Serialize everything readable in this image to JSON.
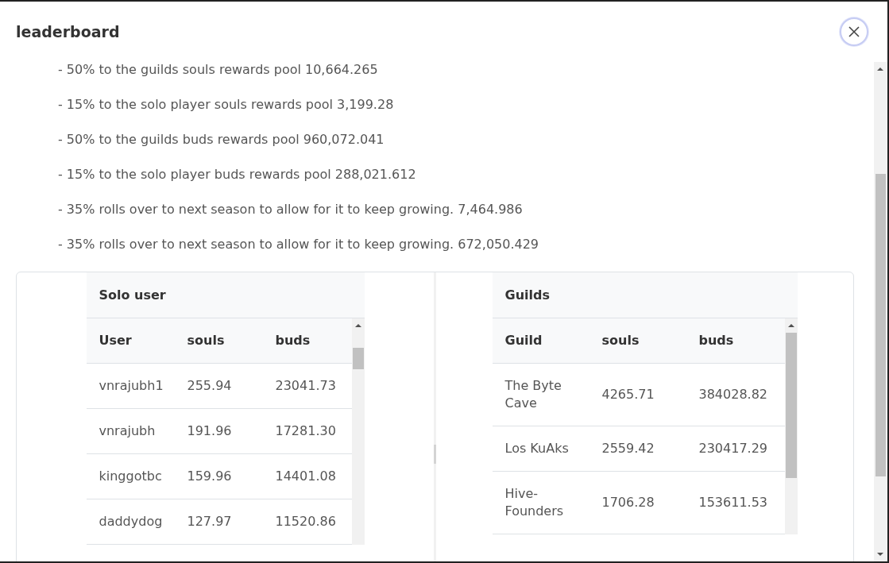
{
  "dialog": {
    "title": "leaderboard"
  },
  "reward_lines": [
    "- 50% to the guilds souls rewards pool 10,664.265",
    "- 15% to the solo player souls rewards pool 3,199.28",
    "- 50% to the guilds buds rewards pool 960,072.041",
    "- 15% to the solo player buds rewards pool 288,021.612",
    "- 35% rolls over to next season to allow for it to keep growing. 7,464.986",
    "- 35% rolls over to next season to allow for it to keep growing. 672,050.429"
  ],
  "tables": [
    {
      "title": "Solo user",
      "columns": [
        "User",
        "souls",
        "buds"
      ],
      "rows": [
        [
          "vnrajubh1",
          "255.94",
          "23041.73"
        ],
        [
          "vnrajubh",
          "191.96",
          "17281.30"
        ],
        [
          "kinggotbc",
          "159.96",
          "14401.08"
        ],
        [
          "daddydog",
          "127.97",
          "11520.86"
        ]
      ]
    },
    {
      "title": "Guilds",
      "columns": [
        "Guild",
        "souls",
        "buds"
      ],
      "rows": [
        [
          "The Byte Cave",
          "4265.71",
          "384028.82"
        ],
        [
          "Los KuAks",
          "2559.42",
          "230417.29"
        ],
        [
          "Hive-Founders",
          "1706.28",
          "153611.53"
        ]
      ]
    }
  ]
}
